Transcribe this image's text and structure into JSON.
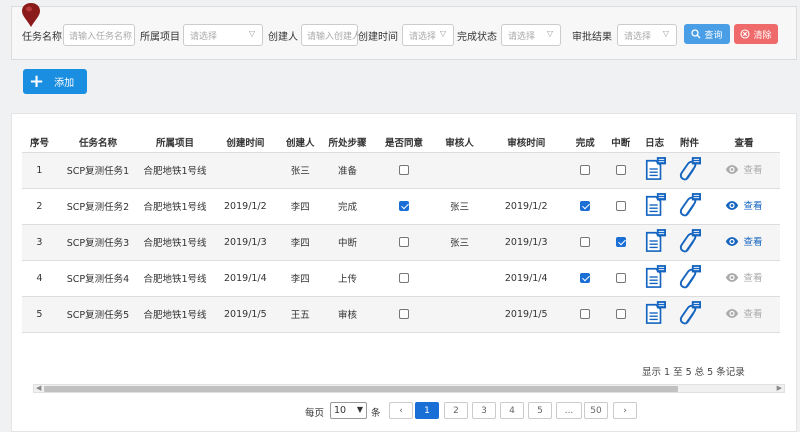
{
  "filters": {
    "task_name_label": "任务名称",
    "task_name_placeholder": "请输入任务名称",
    "project_label": "所属项目",
    "project_value": "请选择",
    "creator_label": "创建人",
    "creator_placeholder": "请输入创建人",
    "created_time_label": "创建时间",
    "created_time_value": "请选择",
    "status_label": "完成状态",
    "status_value": "请选择",
    "approval_label": "审批结果",
    "approval_value": "请选择",
    "search_label": "查询",
    "clear_label": "清除"
  },
  "toolbar": {
    "add_label": "添加"
  },
  "table": {
    "headers": [
      "序号",
      "任务名称",
      "所属项目",
      "创建时间",
      "创建人",
      "所处步骤",
      "是否同意",
      "审核人",
      "审核时间",
      "完成",
      "中断",
      "日志",
      "附件",
      "查看"
    ],
    "rows": [
      {
        "no": "1",
        "task": "SCP复测任务1",
        "project": "合肥地铁1号线",
        "created": "",
        "creator": "张三",
        "step": "准备",
        "agree": false,
        "reviewer": "",
        "review_time": "",
        "done": false,
        "interrupted": false,
        "view": "查看",
        "view_enabled": false
      },
      {
        "no": "2",
        "task": "SCP复测任务2",
        "project": "合肥地铁1号线",
        "created": "2019/1/2",
        "creator": "李四",
        "step": "完成",
        "agree": true,
        "reviewer": "张三",
        "review_time": "2019/1/2",
        "done": true,
        "interrupted": false,
        "view": "查看",
        "view_enabled": true
      },
      {
        "no": "3",
        "task": "SCP复测任务3",
        "project": "合肥地铁1号线",
        "created": "2019/1/3",
        "creator": "李四",
        "step": "中断",
        "agree": false,
        "reviewer": "张三",
        "review_time": "2019/1/3",
        "done": false,
        "interrupted": true,
        "view": "查看",
        "view_enabled": true
      },
      {
        "no": "4",
        "task": "SCP复测任务4",
        "project": "合肥地铁1号线",
        "created": "2019/1/4",
        "creator": "李四",
        "step": "上传",
        "agree": false,
        "reviewer": "",
        "review_time": "2019/1/4",
        "done": true,
        "interrupted": false,
        "view": "查看",
        "view_enabled": false
      },
      {
        "no": "5",
        "task": "SCP复测任务5",
        "project": "合肥地铁1号线",
        "created": "2019/1/5",
        "creator": "王五",
        "step": "审核",
        "agree": false,
        "reviewer": "",
        "review_time": "2019/1/5",
        "done": false,
        "interrupted": false,
        "view": "查看",
        "view_enabled": false
      }
    ]
  },
  "summary": "显示 1 至 5 总 5 条记录",
  "pagination": {
    "per_page_label": "每页",
    "per_page_value": "10",
    "unit_label": "条",
    "prev": "‹",
    "next": "›",
    "pages": [
      "1",
      "2",
      "3",
      "4",
      "5",
      "...",
      "50"
    ],
    "current": "1"
  },
  "colors": {
    "primary": "#1a6fd6",
    "search": "#4a9ee6",
    "clear": "#ef6b6b",
    "add": "#1a8ee0"
  }
}
